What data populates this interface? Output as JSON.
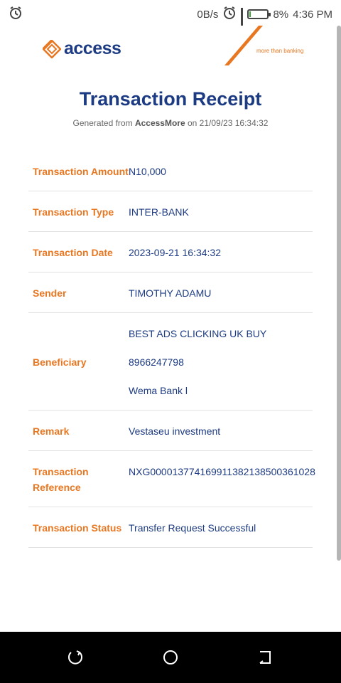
{
  "status_bar": {
    "speed": "0B/s",
    "battery": "8%",
    "time": "4:36 PM",
    "battery_level": 0.08
  },
  "logos": {
    "access_word": "access",
    "tagline": "more than banking"
  },
  "receipt": {
    "title": "Transaction Receipt",
    "generated_prefix": "Generated from",
    "generated_app": "AccessMore",
    "generated_suffix": "on 21/09/23 16:34:32",
    "rows": [
      {
        "label": "Transaction Amount",
        "value": "N10,000"
      },
      {
        "label": "Transaction Type",
        "value": "INTER-BANK"
      },
      {
        "label": "Transaction Date",
        "value": "2023-09-21 16:34:32"
      },
      {
        "label": "Sender",
        "value": "TIMOTHY ADAMU"
      },
      {
        "label": "Beneficiary",
        "values": [
          "BEST ADS CLICKING UK BUY",
          "8966247798",
          "Wema Bank l"
        ]
      },
      {
        "label": "Remark",
        "value": "Vestaseu investment"
      },
      {
        "label": "Transaction Reference",
        "value": "NXG0000137741699113821385003610​28"
      },
      {
        "label": "Transaction Status",
        "value": "Transfer Request Successful"
      }
    ]
  },
  "colors": {
    "brand_blue": "#1d3b82",
    "brand_orange": "#e87722"
  }
}
